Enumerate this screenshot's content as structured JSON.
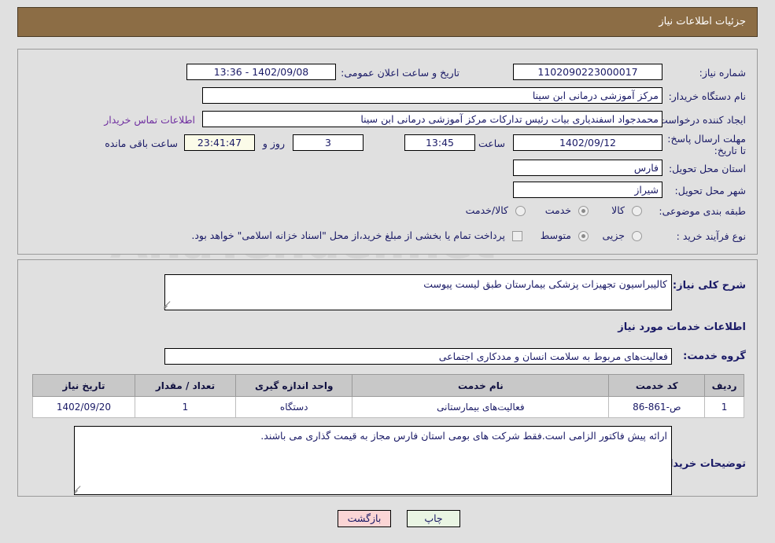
{
  "header": {
    "title": "جزئیات اطلاعات نیاز"
  },
  "watermark": {
    "text": "AnaTender.net",
    "letter": "W"
  },
  "top_form": {
    "need_number_label": "شماره نیاز:",
    "need_number_value": "1102090223000017",
    "public_announce_label": "تاریخ و ساعت اعلان عمومی:",
    "public_announce_value": "1402/09/08 - 13:36",
    "buyer_org_label": "نام دستگاه خریدار:",
    "buyer_org_value": "مرکز آموزشی درمانی ابن سینا",
    "requester_label": "ایجاد کننده درخواست:",
    "requester_value": "محمدجواد  اسفندیاری بیات رئیس تدارکات مرکز آموزشی درمانی ابن سینا",
    "contact_link": "اطلاعات تماس خریدار",
    "deadline_label": "مهلت ارسال پاسخ: تا تاریخ:",
    "deadline_date": "1402/09/12",
    "hour_label": "ساعت",
    "deadline_time": "13:45",
    "days_value": "3",
    "days_label": "روز و",
    "countdown_value": "23:41:47",
    "remaining_label": "ساعت باقی مانده",
    "province_label": "استان محل تحویل:",
    "province_value": "فارس",
    "city_label": "شهر محل تحویل:",
    "city_value": "شیراز",
    "category_label": "طبقه بندی موضوعی:",
    "category_options": [
      "کالا",
      "خدمت",
      "کالا/خدمت"
    ],
    "category_selected": "خدمت",
    "process_label": "نوع فرآیند خرید :",
    "process_options": [
      "جزیی",
      "متوسط"
    ],
    "process_selected": "متوسط",
    "treasury_checkbox_label": "پرداخت تمام یا بخشی از مبلغ خرید،از محل \"اسناد خزانه اسلامی\" خواهد بود.",
    "treasury_checked": false
  },
  "middle": {
    "general_desc_label": "شرح کلی نیاز:",
    "general_desc_value": "کالیبراسیون تجهیزات پزشکی بیمارستان طبق لیست پیوست",
    "services_info_heading": "اطلاعات خدمات مورد نیاز",
    "service_group_label": "گروه خدمت:",
    "service_group_value": "فعالیت‌های مربوط به سلامت انسان و مددکاری اجتماعی"
  },
  "table": {
    "headers": [
      "ردیف",
      "کد خدمت",
      "نام خدمت",
      "واحد اندازه گیری",
      "تعداد / مقدار",
      "تاریخ نیاز"
    ],
    "rows": [
      {
        "row_no": "1",
        "service_code": "ص-861-86",
        "service_name": "فعالیت‌های بیمارستانی",
        "unit": "دستگاه",
        "quantity": "1",
        "need_date": "1402/09/20"
      }
    ]
  },
  "notes": {
    "label": "توضیحات خریدار:",
    "value": "ارائه پیش فاکتور الزامی است.فقط شرکت های بومی استان فارس مجاز به قیمت گذاری می باشند."
  },
  "buttons": {
    "print": "چاپ",
    "back": "بازگشت"
  },
  "colors": {
    "header_bg": "#8c6d45",
    "link": "#7030a0",
    "text": "#1a1a66",
    "page_bg": "#e0e0e0",
    "table_header_bg": "#c8c8c8",
    "print_btn_bg": "#e9f5e3",
    "back_btn_bg": "#fbd5d5",
    "countdown_bg": "#fbfbe8"
  }
}
